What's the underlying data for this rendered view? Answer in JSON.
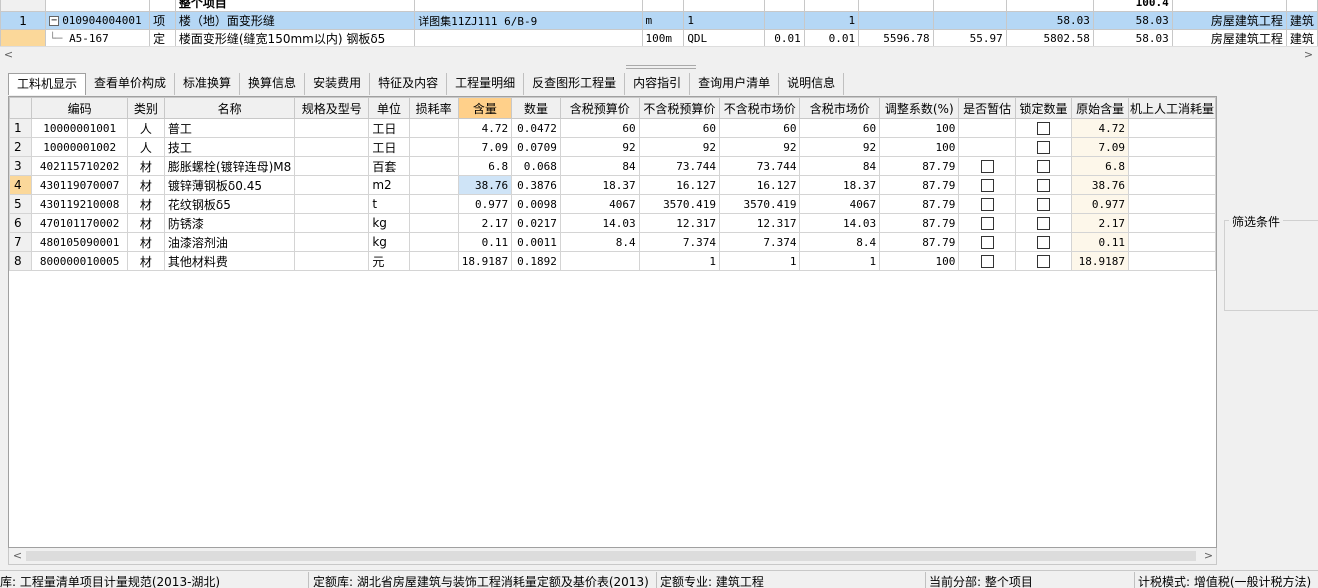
{
  "top_grid": {
    "partial_row": {
      "label": "整个项目",
      "total_right": "100.4"
    },
    "rows": [
      {
        "row_no": "1",
        "code": "010904004001",
        "type": "项",
        "name": "楼（地）面变形缝",
        "spec": "详图集11ZJ111  6/B-9",
        "unit": "m",
        "qty_expr": "1",
        "c1": "",
        "qty": "1",
        "c2": "",
        "c3": "",
        "price": "58.03",
        "total": "58.03",
        "profession": "房屋建筑工程",
        "extra": "建筑"
      },
      {
        "row_no": "",
        "code": "A5-167",
        "type": "定",
        "name": "楼面变形缝(缝宽150mm以内) 钢板δ5",
        "spec": "",
        "unit": "100m",
        "qty_expr": "QDL",
        "c1": "0.01",
        "qty": "0.01",
        "c2": "5596.78",
        "c3": "55.97",
        "price": "5802.58",
        "total": "58.03",
        "profession": "房屋建筑工程",
        "extra": "建筑"
      }
    ]
  },
  "tabs": [
    "工料机显示",
    "查看单价构成",
    "标准换算",
    "换算信息",
    "安装费用",
    "特征及内容",
    "工程量明细",
    "反查图形工程量",
    "内容指引",
    "查询用户清单",
    "说明信息"
  ],
  "res_grid": {
    "headers": [
      "",
      "编码",
      "类别",
      "名称",
      "规格及型号",
      "单位",
      "损耗率",
      "含量",
      "数量",
      "含税预算价",
      "不含税预算价",
      "不含税市场价",
      "含税市场价",
      "调整系数(%)",
      "是否暂估",
      "锁定数量",
      "原始含量",
      "机上人工消耗量"
    ],
    "rows": [
      {
        "no": "1",
        "code": "10000001001",
        "cat": "人",
        "name": "普工",
        "spec": "",
        "unit": "工日",
        "loss": "",
        "content": "4.72",
        "qty": "0.0472",
        "tax_budget": "60",
        "notax_budget": "60",
        "notax_market": "60",
        "tax_market": "60",
        "coef": "100",
        "est": false,
        "lock": true,
        "orig": "4.72",
        "mach": ""
      },
      {
        "no": "2",
        "code": "10000001002",
        "cat": "人",
        "name": "技工",
        "spec": "",
        "unit": "工日",
        "loss": "",
        "content": "7.09",
        "qty": "0.0709",
        "tax_budget": "92",
        "notax_budget": "92",
        "notax_market": "92",
        "tax_market": "92",
        "coef": "100",
        "est": false,
        "lock": true,
        "orig": "7.09",
        "mach": ""
      },
      {
        "no": "3",
        "code": "402115710202",
        "cat": "材",
        "name": "膨胀螺栓(镀锌连母)M8",
        "spec": "",
        "unit": "百套",
        "loss": "",
        "content": "6.8",
        "qty": "0.068",
        "tax_budget": "84",
        "notax_budget": "73.744",
        "notax_market": "73.744",
        "tax_market": "84",
        "coef": "87.79",
        "est": true,
        "lock": true,
        "orig": "6.8",
        "mach": ""
      },
      {
        "no": "4",
        "code": "430119070007",
        "cat": "材",
        "name": "镀锌薄钢板δ0.45",
        "spec": "",
        "unit": "m2",
        "loss": "",
        "content": "38.76",
        "qty": "0.3876",
        "tax_budget": "18.37",
        "notax_budget": "16.127",
        "notax_market": "16.127",
        "tax_market": "18.37",
        "coef": "87.79",
        "est": true,
        "lock": true,
        "orig": "38.76",
        "mach": ""
      },
      {
        "no": "5",
        "code": "430119210008",
        "cat": "材",
        "name": "花纹钢板δ5",
        "spec": "",
        "unit": "t",
        "loss": "",
        "content": "0.977",
        "qty": "0.0098",
        "tax_budget": "4067",
        "notax_budget": "3570.419",
        "notax_market": "3570.419",
        "tax_market": "4067",
        "coef": "87.79",
        "est": true,
        "lock": true,
        "orig": "0.977",
        "mach": ""
      },
      {
        "no": "6",
        "code": "470101170002",
        "cat": "材",
        "name": "防锈漆",
        "spec": "",
        "unit": "kg",
        "loss": "",
        "content": "2.17",
        "qty": "0.0217",
        "tax_budget": "14.03",
        "notax_budget": "12.317",
        "notax_market": "12.317",
        "tax_market": "14.03",
        "coef": "87.79",
        "est": true,
        "lock": true,
        "orig": "2.17",
        "mach": ""
      },
      {
        "no": "7",
        "code": "480105090001",
        "cat": "材",
        "name": "油漆溶剂油",
        "spec": "",
        "unit": "kg",
        "loss": "",
        "content": "0.11",
        "qty": "0.0011",
        "tax_budget": "8.4",
        "notax_budget": "7.374",
        "notax_market": "7.374",
        "tax_market": "8.4",
        "coef": "87.79",
        "est": true,
        "lock": true,
        "orig": "0.11",
        "mach": ""
      },
      {
        "no": "8",
        "code": "800000010005",
        "cat": "材",
        "name": "其他材料费",
        "spec": "",
        "unit": "元",
        "loss": "",
        "content": "18.9187",
        "qty": "0.1892",
        "tax_budget": "",
        "notax_budget": "1",
        "notax_market": "1",
        "tax_market": "1",
        "coef": "100",
        "est": true,
        "lock": true,
        "orig": "18.9187",
        "mach": ""
      }
    ]
  },
  "filter_panel": {
    "title": "筛选条件"
  },
  "status_bar": {
    "s1": "库: 工程量清单项目计量规范(2013-湖北)",
    "s2": "定额库: 湖北省房屋建筑与装饰工程消耗量定额及基价表(2013)",
    "s3": "定额专业: 建筑工程",
    "s4": "当前分部: 整个项目",
    "s5": "计税模式: 增值税(一般计税方法)"
  }
}
